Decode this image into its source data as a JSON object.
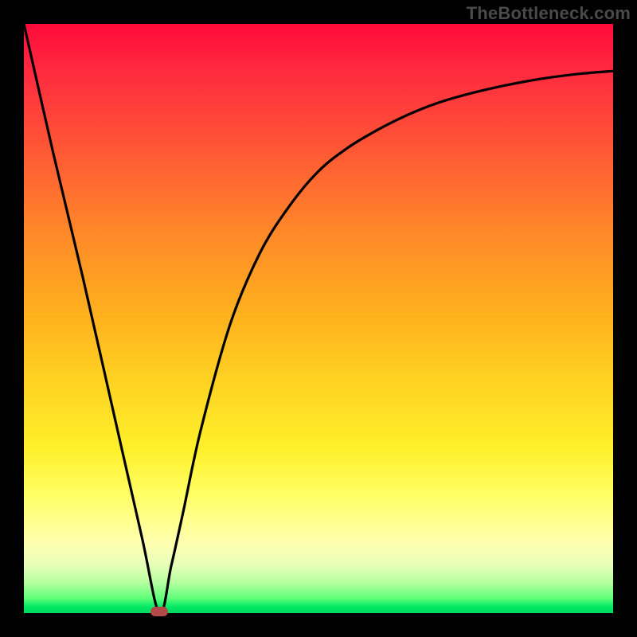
{
  "watermark": "TheBottleneck.com",
  "colors": {
    "frame": "#000000",
    "curve": "#000000",
    "marker": "#b24a4a",
    "gradient_stops": [
      "#ff0a3a",
      "#ff2a40",
      "#ff5a34",
      "#ff8a28",
      "#ffb31e",
      "#ffd623",
      "#fff02a",
      "#ffff66",
      "#ffffb0",
      "#e6ffb8",
      "#b0ff9e",
      "#5eff7a",
      "#00e864",
      "#00d860"
    ]
  },
  "chart_data": {
    "type": "line",
    "title": "",
    "xlabel": "",
    "ylabel": "",
    "xlim": [
      0,
      100
    ],
    "ylim": [
      0,
      100
    ],
    "series": [
      {
        "name": "bottleneck-curve",
        "x": [
          0,
          5,
          10,
          15,
          20,
          23,
          25,
          27,
          30,
          35,
          40,
          45,
          50,
          55,
          60,
          65,
          70,
          75,
          80,
          85,
          90,
          95,
          100
        ],
        "values": [
          100,
          78,
          57,
          35,
          13,
          0,
          8,
          17,
          31,
          49,
          61,
          69,
          75,
          79,
          82,
          84.5,
          86.5,
          88,
          89.2,
          90.2,
          91,
          91.6,
          92
        ]
      }
    ],
    "annotations": [
      {
        "name": "minimum-marker",
        "x": 23,
        "y": 0
      }
    ],
    "background_gradient": {
      "direction": "vertical",
      "meaning": "value-heatmap",
      "top_value": 100,
      "bottom_value": 0
    }
  }
}
